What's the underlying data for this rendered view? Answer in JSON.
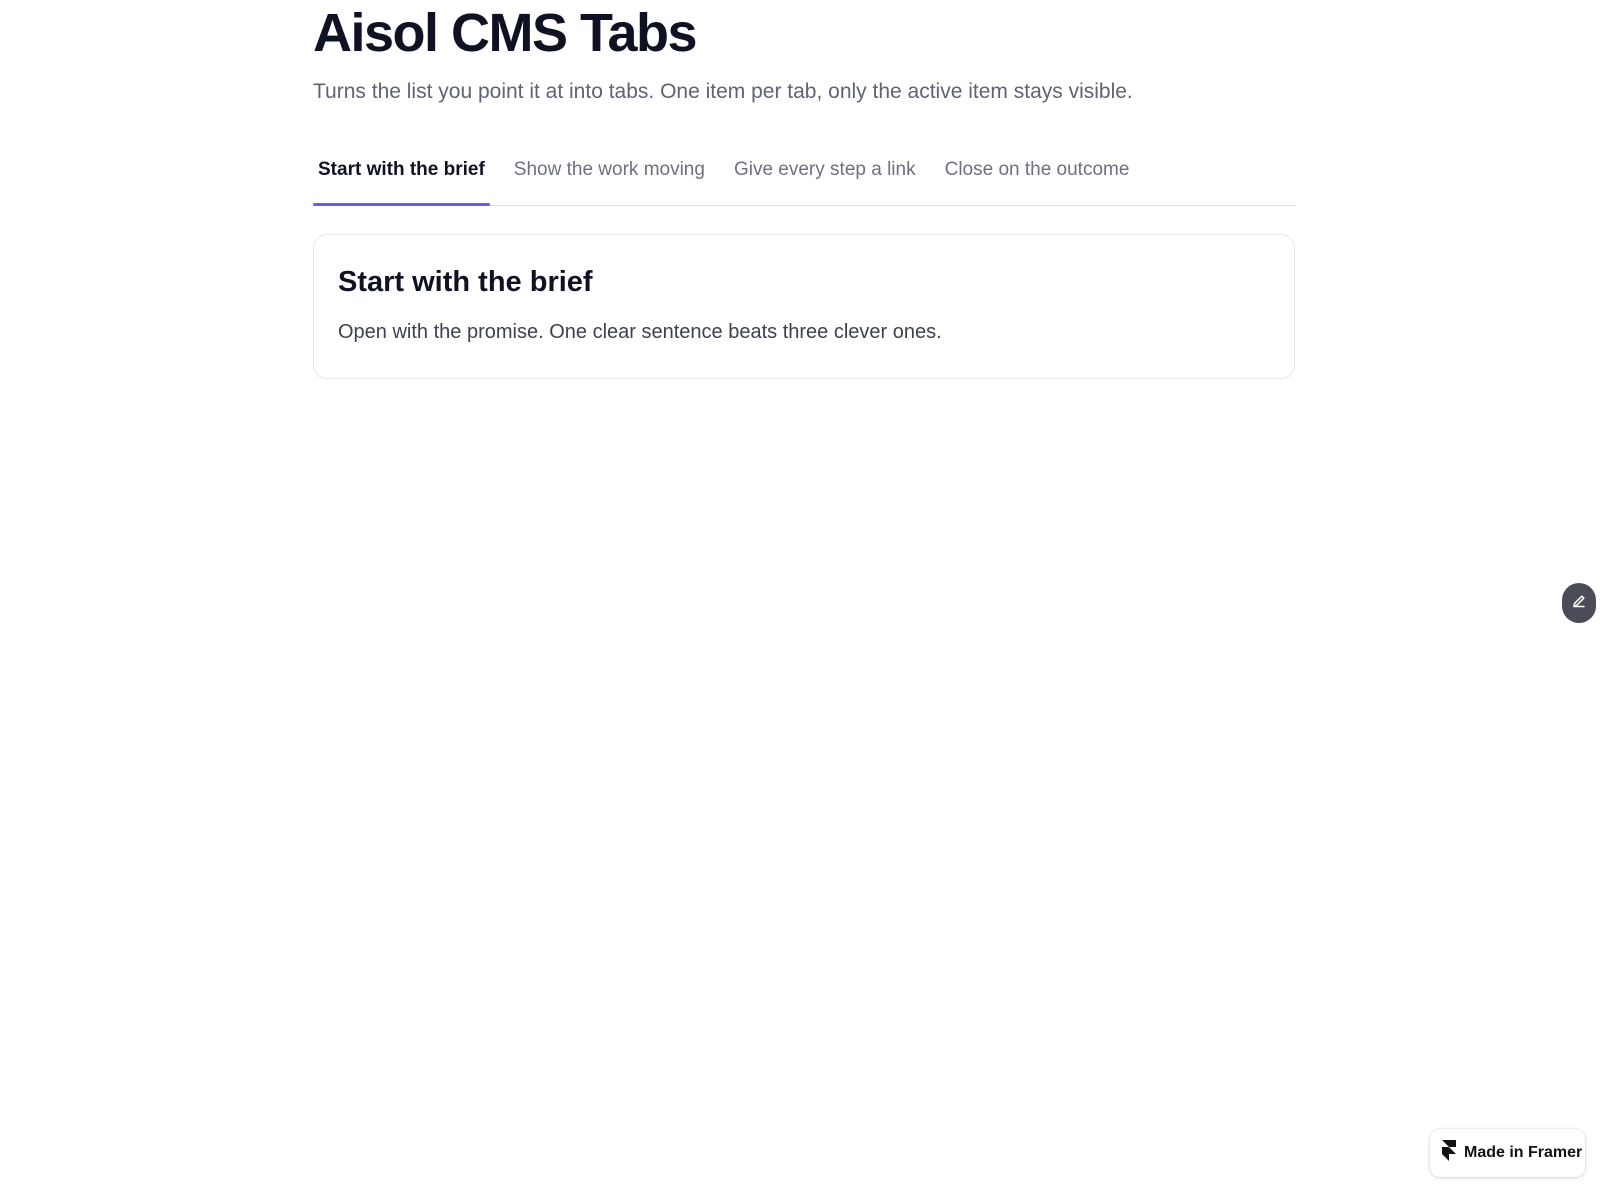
{
  "page": {
    "title": "Aisol CMS Tabs",
    "subtitle": "Turns the list you point it at into tabs. One item per tab, only the active item stays visible."
  },
  "tabs": [
    {
      "label": "Start with the brief",
      "active": true
    },
    {
      "label": "Show the work moving",
      "active": false
    },
    {
      "label": "Give every step a link",
      "active": false
    },
    {
      "label": "Close on the outcome",
      "active": false
    }
  ],
  "panel": {
    "title": "Start with the brief",
    "body": "Open with the promise. One clear sentence beats three clever ones."
  },
  "edit_button": {
    "icon": "pencil-icon"
  },
  "badge": {
    "label": "Made in Framer",
    "icon": "framer-logo-icon"
  },
  "colors": {
    "accent": "#6b5ce7",
    "text_primary": "#0f1222",
    "text_muted": "#6d7080",
    "edit_button_bg": "#4a4d55"
  }
}
